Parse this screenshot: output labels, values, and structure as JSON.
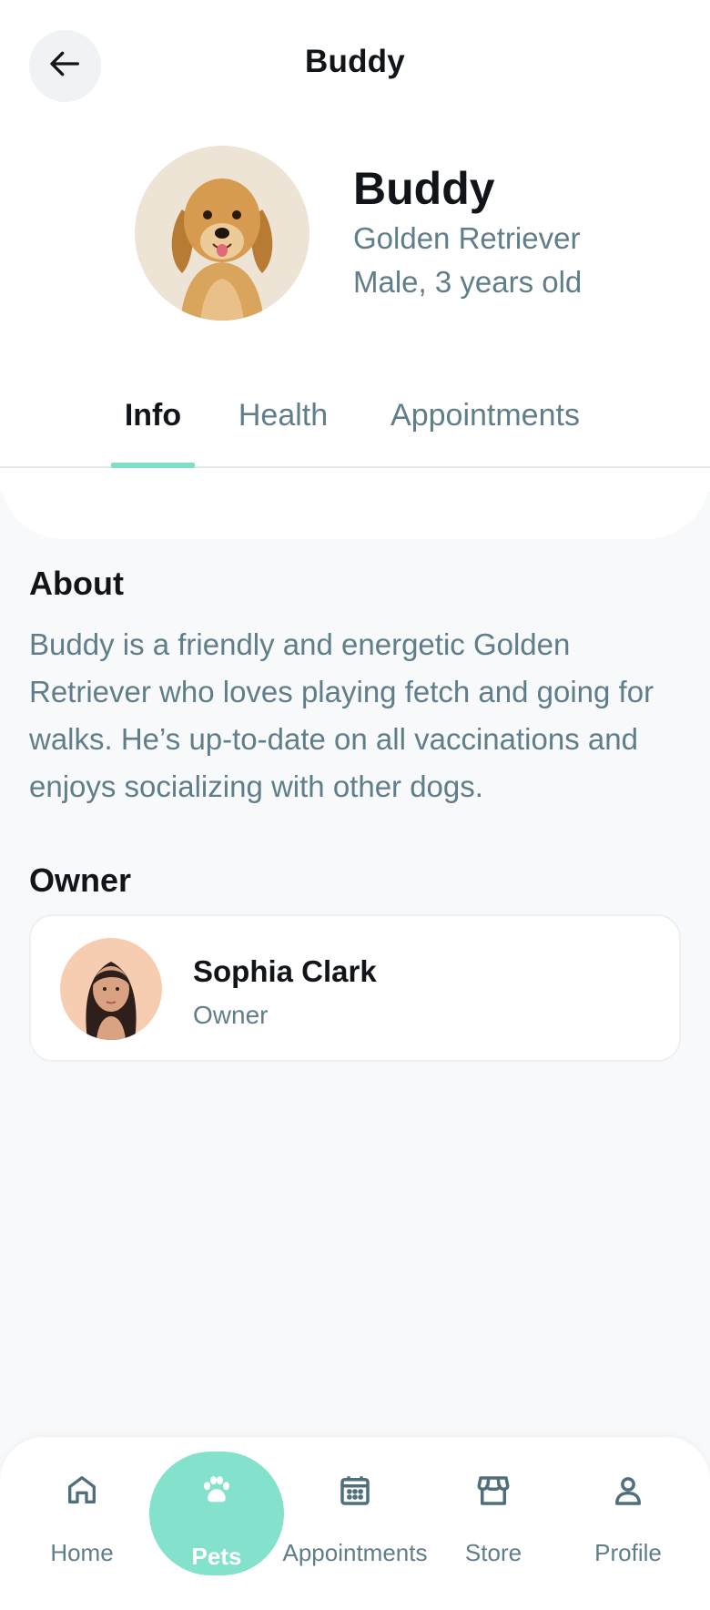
{
  "header": {
    "title": "Buddy",
    "back_icon": "arrow-left-icon"
  },
  "pet": {
    "name": "Buddy",
    "breed": "Golden Retriever",
    "sex_age": "Male, 3 years old",
    "avatar_icon": "dog-avatar"
  },
  "tabs": [
    {
      "label": "Info",
      "active": true
    },
    {
      "label": "Health",
      "active": false
    },
    {
      "label": "Appointments",
      "active": false
    }
  ],
  "about": {
    "title": "About",
    "text": "Buddy is a friendly and energetic Golden Retriever who loves playing fetch and going for walks. He’s up-to-date on all vaccinations and enjoys socializing with other dogs."
  },
  "owner": {
    "section_title": "Owner",
    "name": "Sophia Clark",
    "role": "Owner",
    "avatar_icon": "woman-avatar"
  },
  "nav": [
    {
      "label": "Home",
      "icon": "home-icon",
      "active": false
    },
    {
      "label": "Pets",
      "icon": "paw-icon",
      "active": true
    },
    {
      "label": "Appointments",
      "icon": "calendar-icon",
      "active": false
    },
    {
      "label": "Store",
      "icon": "store-icon",
      "active": false
    },
    {
      "label": "Profile",
      "icon": "user-icon",
      "active": false
    }
  ],
  "colors": {
    "accent": "#7fdec8",
    "muted_text": "#5f7e8a",
    "background": "#f8f9fb"
  }
}
